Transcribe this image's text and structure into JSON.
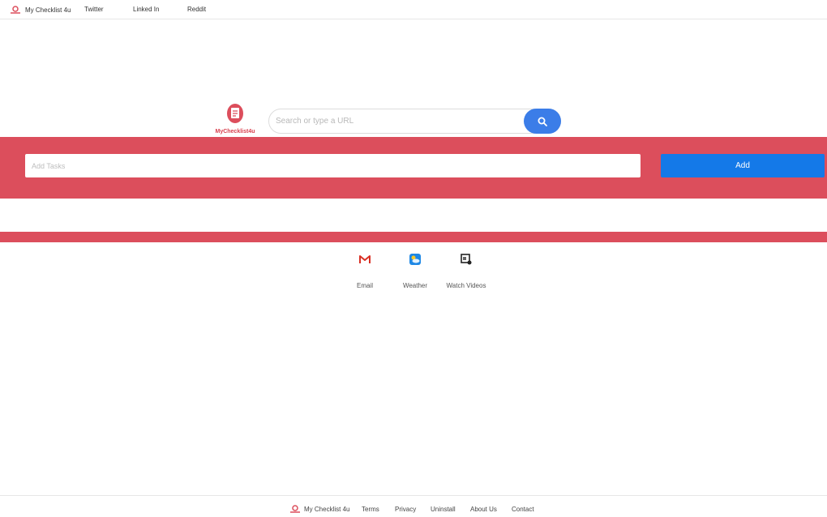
{
  "topnav": {
    "brand": "My Checklist 4u",
    "links": [
      "Twitter",
      "Linked In",
      "Reddit"
    ]
  },
  "logo": {
    "text": "MyChecklist4u"
  },
  "search": {
    "placeholder": "Search or type a URL",
    "button_icon": "search-icon"
  },
  "tasks": {
    "placeholder": "Add Tasks",
    "add_label": "Add"
  },
  "shortcuts": [
    {
      "label": "Email",
      "icon": "gmail-icon"
    },
    {
      "label": "Weather",
      "icon": "weather-icon"
    },
    {
      "label": "Watch Videos",
      "icon": "video-icon"
    }
  ],
  "footer": {
    "brand": "My Checklist 4u",
    "links": [
      "Terms",
      "Privacy",
      "Uninstall",
      "About Us",
      "Contact"
    ]
  },
  "colors": {
    "brand_red": "#dc4e5c",
    "button_blue": "#1479e8",
    "search_blue": "#3b7de8"
  }
}
